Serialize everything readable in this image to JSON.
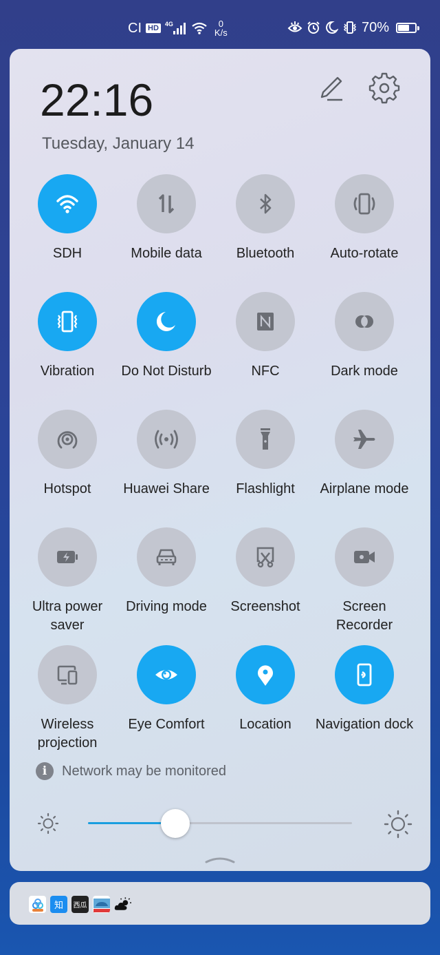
{
  "status_bar": {
    "carrier": "CI",
    "hd_badge": "HD",
    "network_type": "4G",
    "speed_value": "0",
    "speed_unit": "K/s",
    "battery_percent": "70%",
    "battery_level": 0.7,
    "icons": [
      "eye-comfort-icon",
      "alarm-icon",
      "do-not-disturb-icon",
      "vibrate-icon"
    ]
  },
  "header": {
    "time": "22:16",
    "date": "Tuesday, January 14",
    "edit_icon": "pencil-icon",
    "settings_icon": "gear-icon"
  },
  "toggles": [
    {
      "id": "wifi",
      "label": "SDH",
      "icon": "wifi-icon",
      "on": true
    },
    {
      "id": "mobile-data",
      "label": "Mobile data",
      "icon": "data-arrows-icon",
      "on": false
    },
    {
      "id": "bluetooth",
      "label": "Bluetooth",
      "icon": "bluetooth-icon",
      "on": false
    },
    {
      "id": "auto-rotate",
      "label": "Auto-rotate",
      "icon": "rotate-icon",
      "on": false
    },
    {
      "id": "vibration",
      "label": "Vibration",
      "icon": "vibration-icon",
      "on": true
    },
    {
      "id": "do-not-disturb",
      "label": "Do Not Disturb",
      "icon": "moon-icon",
      "on": true
    },
    {
      "id": "nfc",
      "label": "NFC",
      "icon": "nfc-icon",
      "on": false
    },
    {
      "id": "dark-mode",
      "label": "Dark mode",
      "icon": "dark-mode-icon",
      "on": false
    },
    {
      "id": "hotspot",
      "label": "Hotspot",
      "icon": "hotspot-icon",
      "on": false
    },
    {
      "id": "huawei-share",
      "label": "Huawei Share",
      "icon": "share-signal-icon",
      "on": false
    },
    {
      "id": "flashlight",
      "label": "Flashlight",
      "icon": "flashlight-icon",
      "on": false
    },
    {
      "id": "airplane-mode",
      "label": "Airplane mode",
      "icon": "airplane-icon",
      "on": false
    },
    {
      "id": "ultra-power-saver",
      "label": "Ultra power saver",
      "icon": "battery-bolt-icon",
      "on": false
    },
    {
      "id": "driving-mode",
      "label": "Driving mode",
      "icon": "car-icon",
      "on": false
    },
    {
      "id": "screenshot",
      "label": "Screenshot",
      "icon": "scissors-icon",
      "on": false
    },
    {
      "id": "screen-recorder",
      "label": "Screen Recorder",
      "icon": "video-camera-icon",
      "on": false
    },
    {
      "id": "wireless-projection",
      "label": "Wireless projection",
      "icon": "projection-icon",
      "on": false
    },
    {
      "id": "eye-comfort",
      "label": "Eye Comfort",
      "icon": "eye-icon",
      "on": true
    },
    {
      "id": "location",
      "label": "Location",
      "icon": "location-pin-icon",
      "on": true
    },
    {
      "id": "navigation-dock",
      "label": "Navigation dock",
      "icon": "nav-dock-icon",
      "on": true
    }
  ],
  "network_notice": "Network may be monitored",
  "brightness": {
    "level": 0.33,
    "min_icon": "sun-small-icon",
    "max_icon": "sun-large-icon"
  },
  "notification_bar": {
    "app_icons": [
      {
        "name": "baidu-netdisk-icon",
        "text": ""
      },
      {
        "name": "zhihu-icon",
        "text": "知"
      },
      {
        "name": "xigua-icon",
        "text": "西瓜"
      },
      {
        "name": "car-app-icon",
        "text": ""
      },
      {
        "name": "weather-icon",
        "text": ""
      }
    ]
  },
  "colors": {
    "accent": "#18a8f2",
    "tile_off": "#c3c6d0",
    "icon_off": "#6b6e75"
  }
}
